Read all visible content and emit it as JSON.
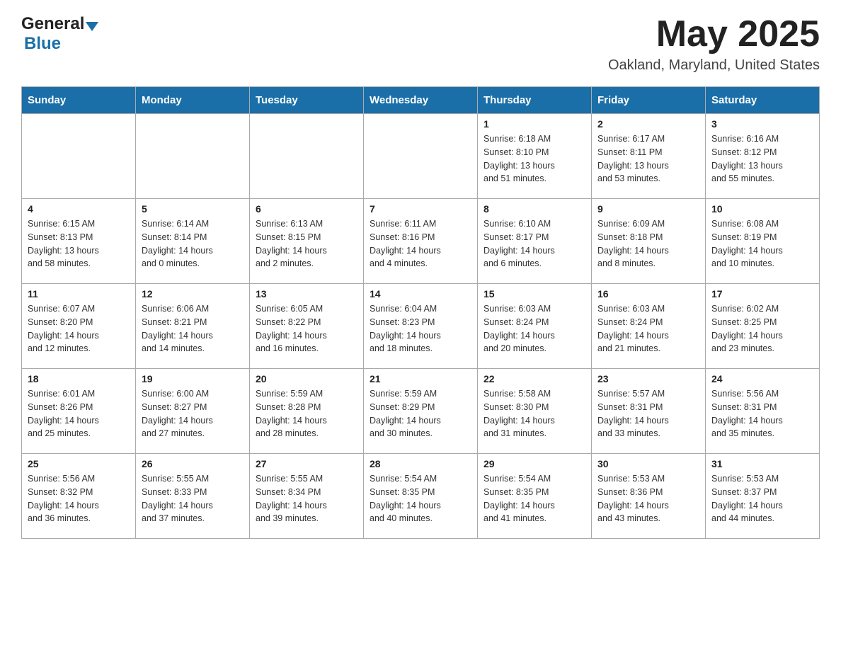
{
  "header": {
    "logo_general": "General",
    "logo_blue": "Blue",
    "month": "May 2025",
    "location": "Oakland, Maryland, United States"
  },
  "days_of_week": [
    "Sunday",
    "Monday",
    "Tuesday",
    "Wednesday",
    "Thursday",
    "Friday",
    "Saturday"
  ],
  "weeks": [
    [
      {
        "day": "",
        "info": ""
      },
      {
        "day": "",
        "info": ""
      },
      {
        "day": "",
        "info": ""
      },
      {
        "day": "",
        "info": ""
      },
      {
        "day": "1",
        "info": "Sunrise: 6:18 AM\nSunset: 8:10 PM\nDaylight: 13 hours\nand 51 minutes."
      },
      {
        "day": "2",
        "info": "Sunrise: 6:17 AM\nSunset: 8:11 PM\nDaylight: 13 hours\nand 53 minutes."
      },
      {
        "day": "3",
        "info": "Sunrise: 6:16 AM\nSunset: 8:12 PM\nDaylight: 13 hours\nand 55 minutes."
      }
    ],
    [
      {
        "day": "4",
        "info": "Sunrise: 6:15 AM\nSunset: 8:13 PM\nDaylight: 13 hours\nand 58 minutes."
      },
      {
        "day": "5",
        "info": "Sunrise: 6:14 AM\nSunset: 8:14 PM\nDaylight: 14 hours\nand 0 minutes."
      },
      {
        "day": "6",
        "info": "Sunrise: 6:13 AM\nSunset: 8:15 PM\nDaylight: 14 hours\nand 2 minutes."
      },
      {
        "day": "7",
        "info": "Sunrise: 6:11 AM\nSunset: 8:16 PM\nDaylight: 14 hours\nand 4 minutes."
      },
      {
        "day": "8",
        "info": "Sunrise: 6:10 AM\nSunset: 8:17 PM\nDaylight: 14 hours\nand 6 minutes."
      },
      {
        "day": "9",
        "info": "Sunrise: 6:09 AM\nSunset: 8:18 PM\nDaylight: 14 hours\nand 8 minutes."
      },
      {
        "day": "10",
        "info": "Sunrise: 6:08 AM\nSunset: 8:19 PM\nDaylight: 14 hours\nand 10 minutes."
      }
    ],
    [
      {
        "day": "11",
        "info": "Sunrise: 6:07 AM\nSunset: 8:20 PM\nDaylight: 14 hours\nand 12 minutes."
      },
      {
        "day": "12",
        "info": "Sunrise: 6:06 AM\nSunset: 8:21 PM\nDaylight: 14 hours\nand 14 minutes."
      },
      {
        "day": "13",
        "info": "Sunrise: 6:05 AM\nSunset: 8:22 PM\nDaylight: 14 hours\nand 16 minutes."
      },
      {
        "day": "14",
        "info": "Sunrise: 6:04 AM\nSunset: 8:23 PM\nDaylight: 14 hours\nand 18 minutes."
      },
      {
        "day": "15",
        "info": "Sunrise: 6:03 AM\nSunset: 8:24 PM\nDaylight: 14 hours\nand 20 minutes."
      },
      {
        "day": "16",
        "info": "Sunrise: 6:03 AM\nSunset: 8:24 PM\nDaylight: 14 hours\nand 21 minutes."
      },
      {
        "day": "17",
        "info": "Sunrise: 6:02 AM\nSunset: 8:25 PM\nDaylight: 14 hours\nand 23 minutes."
      }
    ],
    [
      {
        "day": "18",
        "info": "Sunrise: 6:01 AM\nSunset: 8:26 PM\nDaylight: 14 hours\nand 25 minutes."
      },
      {
        "day": "19",
        "info": "Sunrise: 6:00 AM\nSunset: 8:27 PM\nDaylight: 14 hours\nand 27 minutes."
      },
      {
        "day": "20",
        "info": "Sunrise: 5:59 AM\nSunset: 8:28 PM\nDaylight: 14 hours\nand 28 minutes."
      },
      {
        "day": "21",
        "info": "Sunrise: 5:59 AM\nSunset: 8:29 PM\nDaylight: 14 hours\nand 30 minutes."
      },
      {
        "day": "22",
        "info": "Sunrise: 5:58 AM\nSunset: 8:30 PM\nDaylight: 14 hours\nand 31 minutes."
      },
      {
        "day": "23",
        "info": "Sunrise: 5:57 AM\nSunset: 8:31 PM\nDaylight: 14 hours\nand 33 minutes."
      },
      {
        "day": "24",
        "info": "Sunrise: 5:56 AM\nSunset: 8:31 PM\nDaylight: 14 hours\nand 35 minutes."
      }
    ],
    [
      {
        "day": "25",
        "info": "Sunrise: 5:56 AM\nSunset: 8:32 PM\nDaylight: 14 hours\nand 36 minutes."
      },
      {
        "day": "26",
        "info": "Sunrise: 5:55 AM\nSunset: 8:33 PM\nDaylight: 14 hours\nand 37 minutes."
      },
      {
        "day": "27",
        "info": "Sunrise: 5:55 AM\nSunset: 8:34 PM\nDaylight: 14 hours\nand 39 minutes."
      },
      {
        "day": "28",
        "info": "Sunrise: 5:54 AM\nSunset: 8:35 PM\nDaylight: 14 hours\nand 40 minutes."
      },
      {
        "day": "29",
        "info": "Sunrise: 5:54 AM\nSunset: 8:35 PM\nDaylight: 14 hours\nand 41 minutes."
      },
      {
        "day": "30",
        "info": "Sunrise: 5:53 AM\nSunset: 8:36 PM\nDaylight: 14 hours\nand 43 minutes."
      },
      {
        "day": "31",
        "info": "Sunrise: 5:53 AM\nSunset: 8:37 PM\nDaylight: 14 hours\nand 44 minutes."
      }
    ]
  ]
}
